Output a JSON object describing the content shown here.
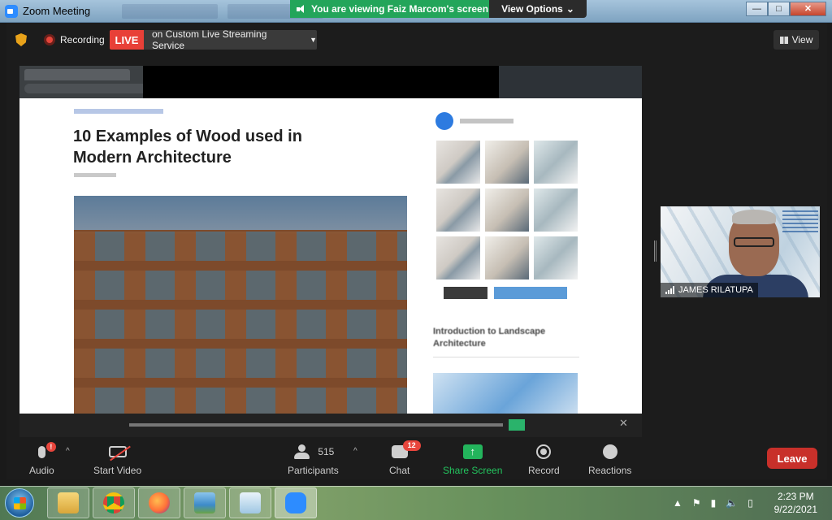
{
  "window": {
    "title": "Zoom Meeting",
    "share_banner": "You are viewing Faiz Marcom's screen",
    "view_options": "View Options",
    "controls": {
      "minimize": "—",
      "maximize": "□",
      "close": "✕"
    }
  },
  "topbar": {
    "recording_label": "Recording",
    "live_label": "LIVE",
    "live_service": "on Custom Live Streaming Service",
    "view_label": "View"
  },
  "shared_page": {
    "headline": "10 Examples of Wood used in Modern Architecture",
    "side_heading": "Introduction to Landscape Architecture"
  },
  "video": {
    "participant_name": "JAMES RILATUPA"
  },
  "toolbar": {
    "audio_label": "Audio",
    "audio_badge": "!",
    "video_label": "Start Video",
    "participants_label": "Participants",
    "participants_count": "515",
    "chat_label": "Chat",
    "chat_badge": "12",
    "share_label": "Share Screen",
    "record_label": "Record",
    "reactions_label": "Reactions",
    "leave_label": "Leave"
  },
  "taskbar": {
    "apps": [
      "windows-explorer",
      "chrome",
      "firefox",
      "photos",
      "notepad",
      "zoom"
    ],
    "time": "2:23 PM",
    "date": "9/22/2021"
  },
  "colors": {
    "share_green": "#23a55a",
    "live_red": "#e84038",
    "leave_red": "#c8302a",
    "badge_red": "#e8453c",
    "zoom_blue": "#2d8cff"
  }
}
